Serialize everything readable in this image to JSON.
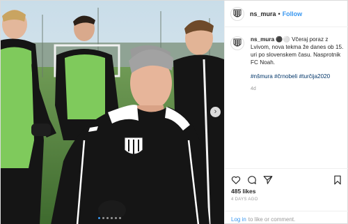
{
  "post": {
    "username": "ns_mura",
    "separator": "•",
    "follow_label": "Follow",
    "caption_user": "ns_mura",
    "caption_text": "⚫⚪ Včeraj poraz z Lvivom, nova tekma že danes ob 15. uri po slovenskem času. Nasprotnik FC Noah.",
    "hashtags": "#nšmura #črnobeli #turčija2020",
    "age": "4d",
    "likes": "485 likes",
    "posted": "4 DAYS AGO",
    "login_link": "Log in",
    "login_rest": "to like or comment.",
    "carousel": {
      "dots": 6,
      "active_index": 0,
      "next_icon": "chevron-right-icon"
    }
  },
  "icons": {
    "like": "heart-icon",
    "comment": "comment-icon",
    "share": "share-icon",
    "save": "bookmark-icon",
    "avatar": "club-crest-icon"
  },
  "colors": {
    "link_blue": "#3897f0",
    "hashtag_blue": "#003569",
    "muted": "#999999",
    "jersey_black": "#151515",
    "bib_green": "#7fca5c",
    "pitch_green": "#4f7a3a"
  }
}
